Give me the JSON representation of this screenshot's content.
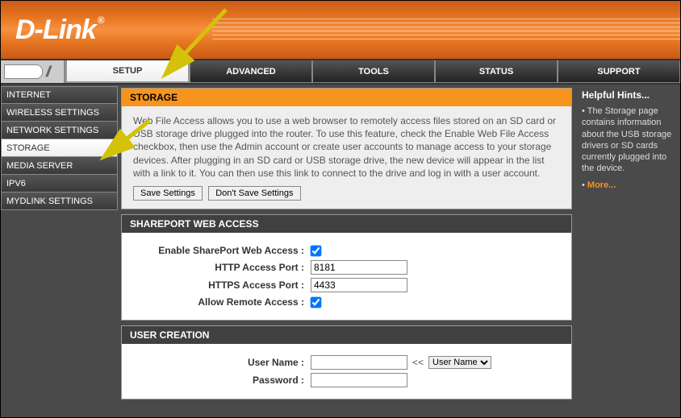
{
  "brand": "D-Link",
  "tabs": {
    "setup": "SETUP",
    "advanced": "ADVANCED",
    "tools": "TOOLS",
    "status": "STATUS",
    "support": "SUPPORT"
  },
  "sidebar": {
    "items": [
      "INTERNET",
      "WIRELESS SETTINGS",
      "NETWORK SETTINGS",
      "STORAGE",
      "MEDIA SERVER",
      "IPV6",
      "MYDLINK SETTINGS"
    ],
    "active_index": 3
  },
  "storage_panel": {
    "title": "STORAGE",
    "desc": "Web File Access allows you to use a web browser to remotely access files stored on an SD card or USB storage drive plugged into the router. To use this feature, check the Enable Web File Access checkbox, then use the Admin account or create user accounts to manage access to your storage devices. After plugging in an SD card or USB storage drive, the new device will appear in the list with a link to it. You can then use this link to connect to the drive and log in with a user account.",
    "save_btn": "Save Settings",
    "dont_save_btn": "Don't Save Settings"
  },
  "shareport": {
    "title": "SHAREPORT WEB ACCESS",
    "enable_label": "Enable SharePort Web Access :",
    "http_label": "HTTP Access Port :",
    "http_value": "8181",
    "https_label": "HTTPS Access Port :",
    "https_value": "4433",
    "remote_label": "Allow Remote Access :"
  },
  "user_creation": {
    "title": "USER CREATION",
    "username_label": "User Name :",
    "username_value": "",
    "password_label": "Password :",
    "password_value": "",
    "select_label": "User Name",
    "arrows": "<<"
  },
  "hints": {
    "title": "Helpful Hints...",
    "text": "The Storage page contains information about the USB storage drivers or SD cards currently plugged into the device.",
    "more": "More..."
  }
}
